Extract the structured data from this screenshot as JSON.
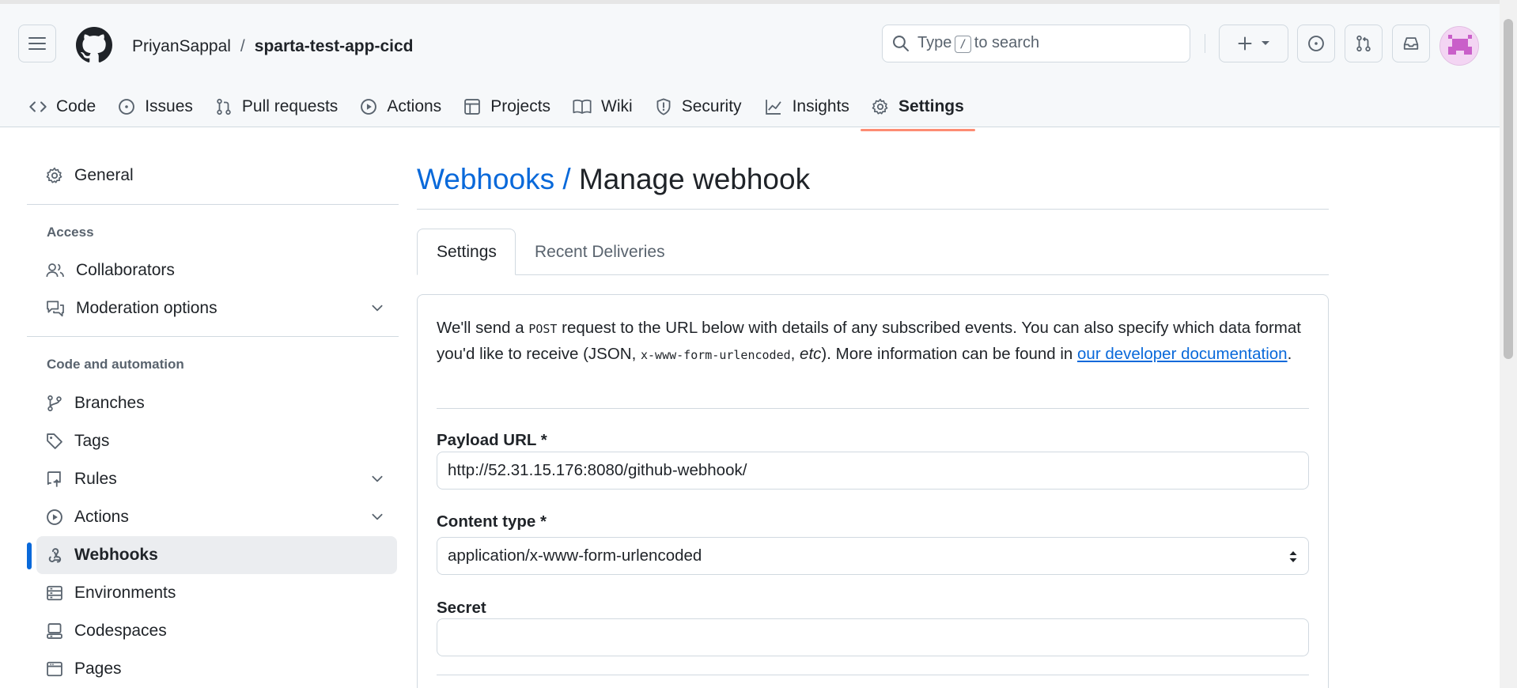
{
  "header": {
    "owner": "PriyanSappal",
    "separator": "/",
    "repo": "sparta-test-app-cicd",
    "search_prefix": "Type",
    "search_key": "/",
    "search_suffix": "to search"
  },
  "repo_tabs": [
    {
      "label": "Code",
      "icon": "code-icon"
    },
    {
      "label": "Issues",
      "icon": "issue-icon"
    },
    {
      "label": "Pull requests",
      "icon": "pull-request-icon"
    },
    {
      "label": "Actions",
      "icon": "play-icon"
    },
    {
      "label": "Projects",
      "icon": "table-icon"
    },
    {
      "label": "Wiki",
      "icon": "book-icon"
    },
    {
      "label": "Security",
      "icon": "shield-icon"
    },
    {
      "label": "Insights",
      "icon": "graph-icon"
    },
    {
      "label": "Settings",
      "icon": "gear-icon",
      "active": true
    }
  ],
  "sidebar": {
    "general": "General",
    "access_heading": "Access",
    "collaborators": "Collaborators",
    "moderation": "Moderation options",
    "code_heading": "Code and automation",
    "branches": "Branches",
    "tags": "Tags",
    "rules": "Rules",
    "actions": "Actions",
    "webhooks": "Webhooks",
    "environments": "Environments",
    "codespaces": "Codespaces",
    "pages": "Pages"
  },
  "main": {
    "crumb": "Webhooks /",
    "title": "Manage webhook",
    "tabs": [
      "Settings",
      "Recent Deliveries"
    ],
    "intro_1": "We'll send a ",
    "intro_post": "POST",
    "intro_2": " request to the URL below with details of any subscribed events. You can also specify which data format you'd like to receive (JSON, ",
    "intro_code": "x-www-form-urlencoded",
    "intro_3": ", ",
    "intro_etc": "etc",
    "intro_4": "). More information can be found in ",
    "intro_link": "our developer documentation",
    "intro_5": ".",
    "payload_label": "Payload URL *",
    "payload_value": "http://52.31.15.176:8080/github-webhook/",
    "content_type_label": "Content type *",
    "content_type_value": "application/x-www-form-urlencoded",
    "secret_label": "Secret",
    "secret_value": ""
  },
  "colors": {
    "accent": "#0969da",
    "active_tab_underline": "#fd8c73",
    "border": "#d1d9e0"
  }
}
